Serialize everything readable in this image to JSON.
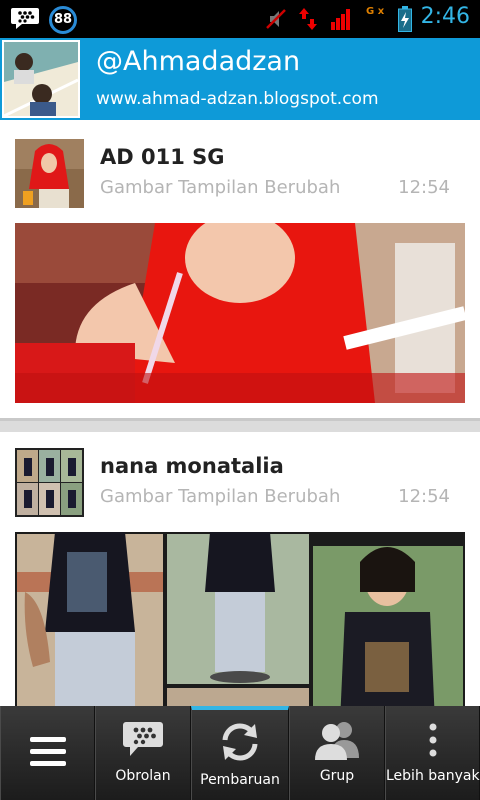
{
  "status_bar": {
    "notification_count": "88",
    "gx_label": "G x",
    "time": "2:46",
    "icons": [
      "bbm-notification-icon",
      "mute-icon",
      "data-transfer-icon",
      "signal-icon",
      "battery-charging-icon"
    ]
  },
  "profile": {
    "name": "@Ahmadadzan",
    "url": "www.ahmad-adzan.blogspot.com"
  },
  "updates": [
    {
      "name": "AD 011 SG",
      "status": "Gambar Tampilan Berubah",
      "time": "12:54"
    },
    {
      "name": "nana monatalia",
      "status": "Gambar Tampilan Berubah",
      "time": "12:54"
    }
  ],
  "bottom_nav": {
    "items": [
      {
        "label": "",
        "icon": "menu-icon"
      },
      {
        "label": "Obrolan",
        "icon": "chat-icon"
      },
      {
        "label": "Pembaruan",
        "icon": "refresh-icon",
        "active": true
      },
      {
        "label": "Grup",
        "icon": "group-icon"
      },
      {
        "label": "Lebih banyak",
        "icon": "more-icon"
      }
    ]
  },
  "colors": {
    "accent": "#33b5e5",
    "header_blue": "#0e9ad8",
    "status_gray": "#b5b5b5"
  }
}
